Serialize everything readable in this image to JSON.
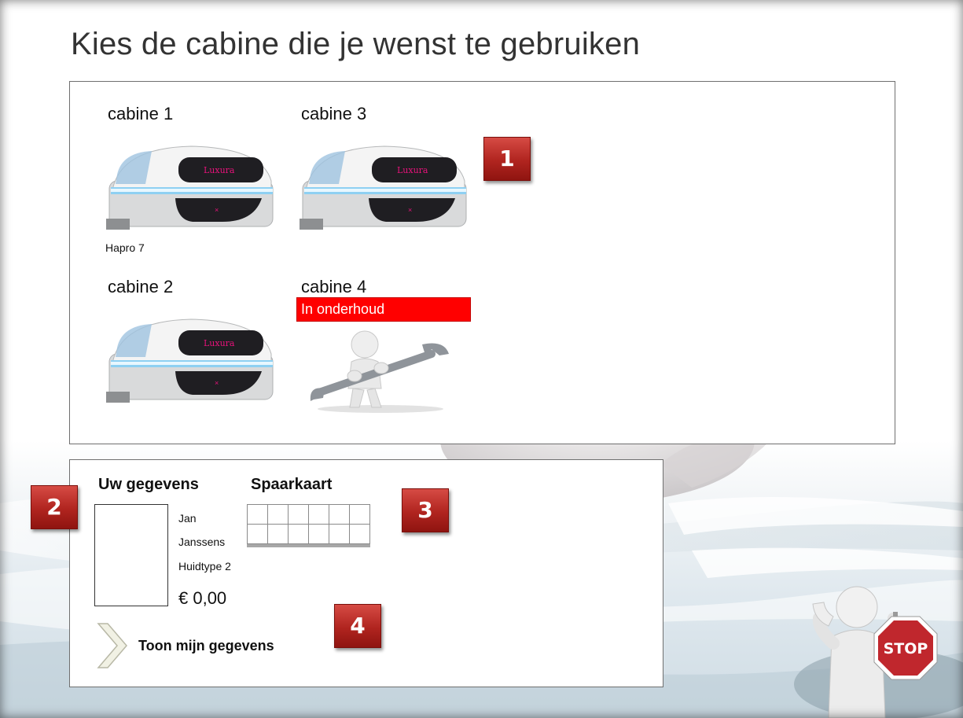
{
  "page": {
    "title": "Kies de cabine die je wenst te gebruiken"
  },
  "cabins": [
    {
      "label": "cabine 1",
      "model": "Hapro 7",
      "status": "available",
      "brand_text": "Luxura"
    },
    {
      "label": "cabine 3",
      "status": "available",
      "brand_text": "Luxura"
    },
    {
      "label": "cabine 2",
      "status": "available",
      "brand_text": "Luxura"
    },
    {
      "label": "cabine 4",
      "status": "maintenance",
      "status_text": "In onderhoud",
      "status_color": "#ff0000"
    }
  ],
  "user": {
    "heading": "Uw gegevens",
    "first_name": "Jan",
    "last_name": "Janssens",
    "skin_type": "Huidtype 2",
    "balance": "€ 0,00",
    "show_button_label": "Toon mijn gegevens"
  },
  "savings_card": {
    "heading": "Spaarkaart",
    "rows": 2,
    "columns": 6,
    "stamps_filled": 0
  },
  "callouts": [
    "1",
    "2",
    "3",
    "4"
  ],
  "stop_sign": {
    "text": "STOP",
    "color": "#c0272d"
  },
  "icons": [
    "tanning-bed-icon",
    "wrench-figure-icon",
    "chevron-right-icon",
    "stop-sign-icon"
  ]
}
